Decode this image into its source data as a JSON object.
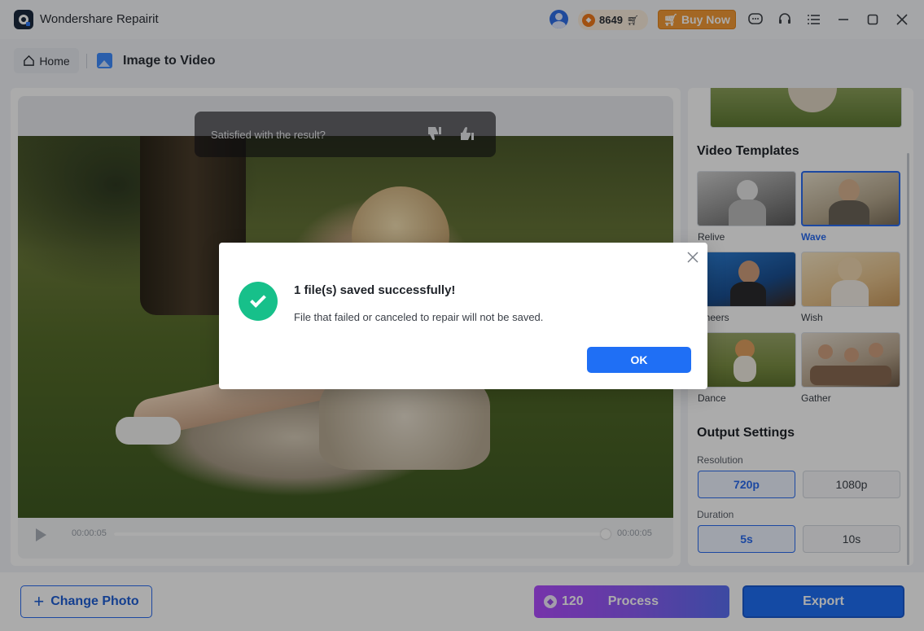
{
  "app": {
    "title": "Wondershare Repairit",
    "credits": "8649",
    "buy_now": "Buy Now"
  },
  "breadcrumb": {
    "home": "Home",
    "page_title": "Image to Video"
  },
  "player": {
    "time_current": "00:00:05",
    "time_total": "00:00:05",
    "progress": 1.0
  },
  "feedback": {
    "question": "Satisfied with the result?"
  },
  "templates": {
    "title": "Video Templates",
    "items": [
      {
        "label": "Relive",
        "active": false
      },
      {
        "label": "Wave",
        "active": true
      },
      {
        "label": "Cheers",
        "active": false
      },
      {
        "label": "Wish",
        "active": false
      },
      {
        "label": "Dance",
        "active": false
      },
      {
        "label": "Gather",
        "active": false
      }
    ]
  },
  "output": {
    "title": "Output Settings",
    "resolution_label": "Resolution",
    "resolution_options": [
      "720p",
      "1080p"
    ],
    "resolution_selected": "720p",
    "duration_label": "Duration",
    "duration_options": [
      "5s",
      "10s"
    ],
    "duration_selected": "5s"
  },
  "bottom": {
    "change_photo": "Change Photo",
    "process_cost": "120",
    "process": "Process",
    "export": "Export"
  },
  "dialog": {
    "title": "1 file(s) saved successfully!",
    "message": "File that failed or canceled to repair will not be saved.",
    "ok": "OK"
  },
  "colors": {
    "accent": "#1f6ff5",
    "success": "#17c08a",
    "buy_now": "#f39a36"
  }
}
